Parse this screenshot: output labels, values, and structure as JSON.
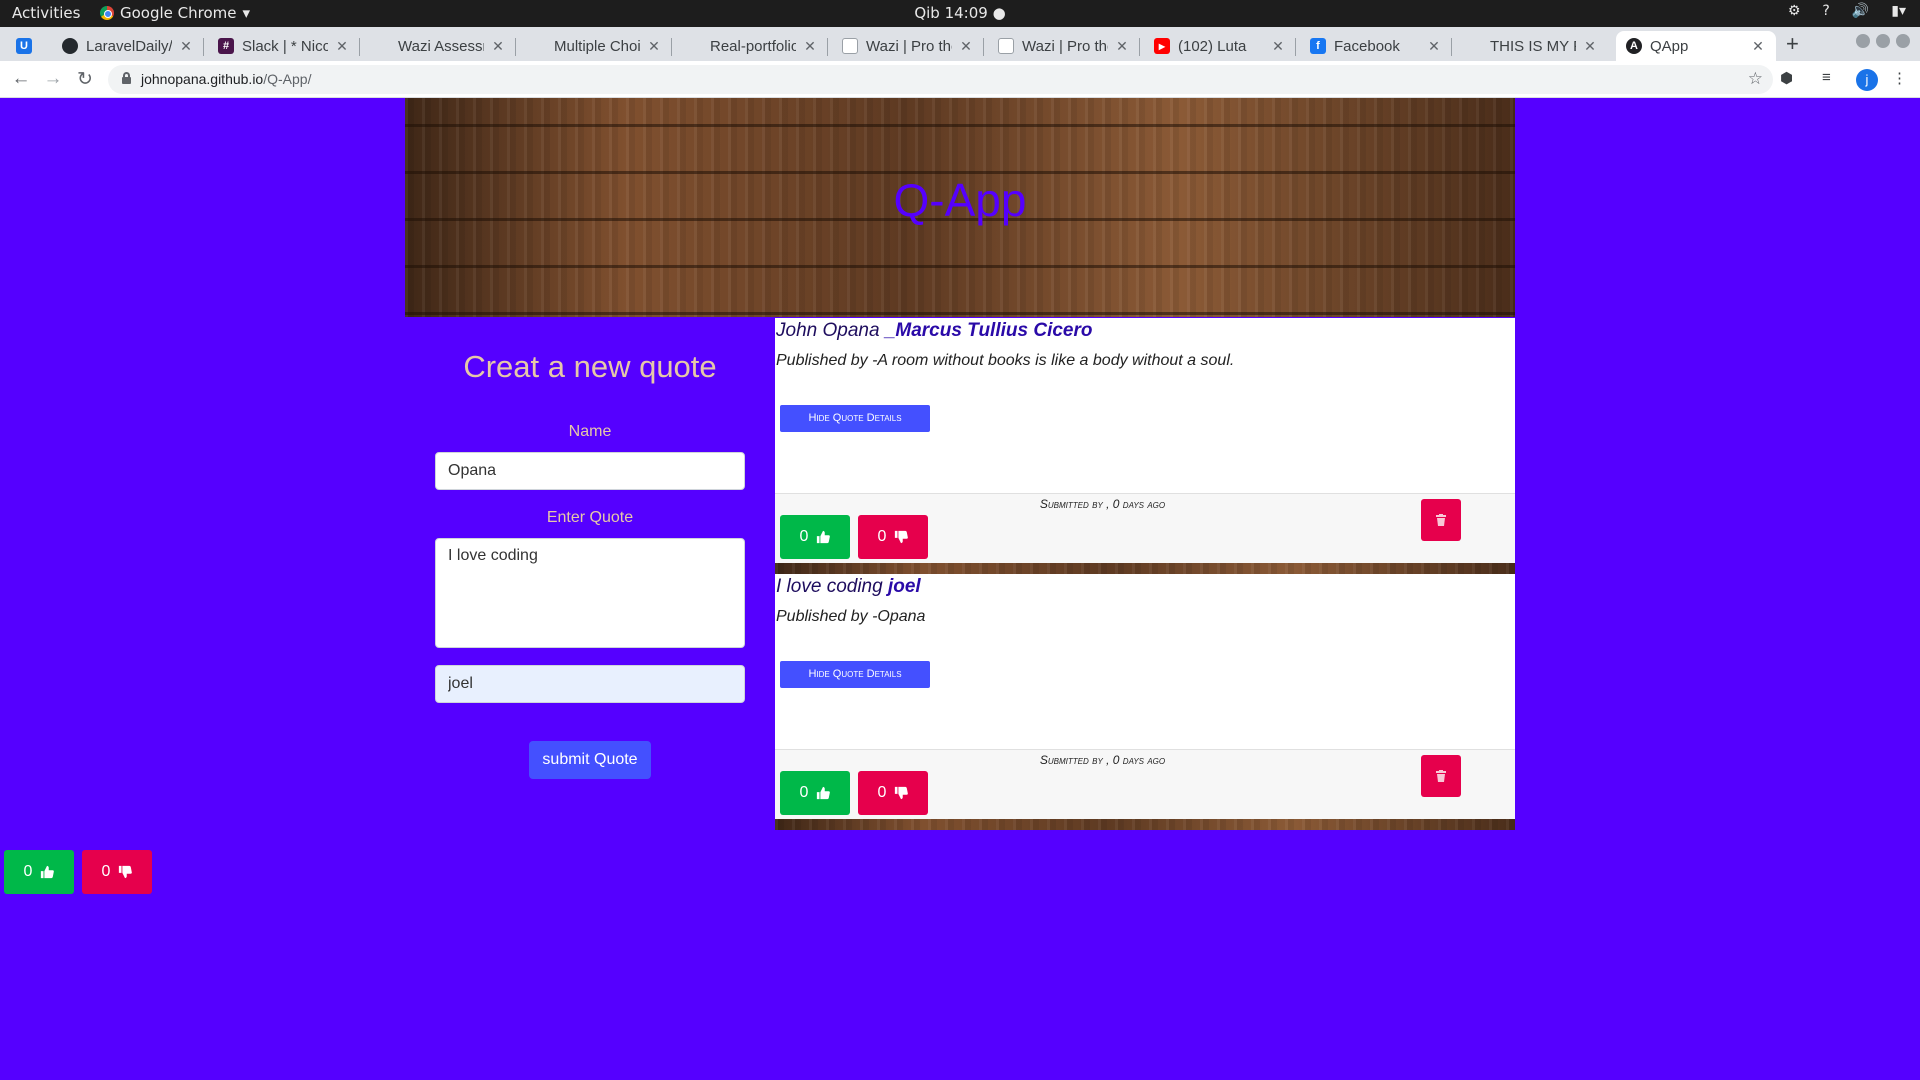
{
  "topbar": {
    "activities": "Activities",
    "app_name": "Google Chrome",
    "clock": "Qib 14:09"
  },
  "tabs": [
    {
      "title": "",
      "icon": "bookmark-icon"
    },
    {
      "title": "LaravelDaily/l",
      "icon": "github-icon"
    },
    {
      "title": "Slack | * Nicol",
      "icon": "slack-icon"
    },
    {
      "title": "Wazi Assessm",
      "icon": "page-icon"
    },
    {
      "title": "Multiple Choi",
      "icon": "page-icon"
    },
    {
      "title": "Real-portfolio",
      "icon": "page-icon"
    },
    {
      "title": "Wazi | Pro the",
      "icon": "page-icon"
    },
    {
      "title": "Wazi | Pro the",
      "icon": "page-icon"
    },
    {
      "title": "(102) Luta",
      "icon": "youtube-icon"
    },
    {
      "title": "Facebook",
      "icon": "facebook-icon"
    },
    {
      "title": "THIS IS MY Po",
      "icon": "page-icon"
    },
    {
      "title": "QApp",
      "icon": "angular-icon"
    }
  ],
  "browser": {
    "url_host": "johnopana.github.io",
    "url_path": "/Q-App/",
    "profile_initial": "j"
  },
  "app": {
    "title": "Q-App",
    "form": {
      "title": "Creat a new quote",
      "name_label": "Name",
      "name_value": "Opana",
      "quote_label": "Enter Quote",
      "quote_value": "I love coding",
      "author_value": "joel",
      "submit_label": "submit Quote"
    },
    "quotes": [
      {
        "text": "John Opana ",
        "author": "_Marcus Tullius Cicero",
        "published": "Published by -A room without books is like a body without a soul.",
        "toggle_label": "Hide Quote Details",
        "submitted": "Submitted by , 0 days ago",
        "upvotes": "0",
        "downvotes": "0"
      },
      {
        "text": "I love coding ",
        "author": "joel",
        "published": "Published by -Opana",
        "toggle_label": "Hide Quote Details",
        "submitted": "Submitted by , 0 days ago",
        "upvotes": "0",
        "downvotes": "0"
      }
    ],
    "standalone_votes": {
      "upvotes": "0",
      "downvotes": "0"
    }
  },
  "colors": {
    "page_background": "#5500ff",
    "primary_button": "#4450ff",
    "upvote": "#00b849",
    "downvote": "#e6004c"
  }
}
